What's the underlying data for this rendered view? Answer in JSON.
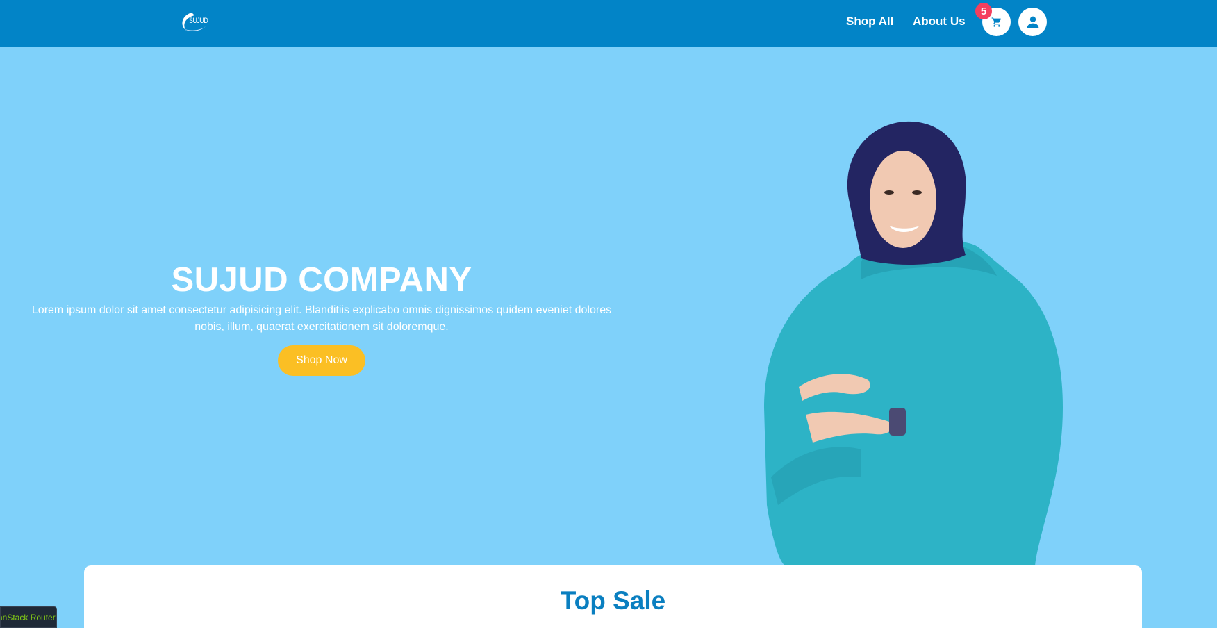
{
  "nav": {
    "logo_text": "SUJUD",
    "links": [
      {
        "label": "Shop All"
      },
      {
        "label": "About Us"
      }
    ],
    "cart_count": "5",
    "cart_icon": "cart-icon",
    "user_icon": "user-icon"
  },
  "hero": {
    "title": "SUJUD COMPANY",
    "description": "Lorem ipsum dolor sit amet consectetur adipisicing elit. Blanditiis explicabo omnis dignissimos quidem eveniet dolores nobis, illum, quaerat exercitationem sit doloremque.",
    "cta_label": "Shop Now"
  },
  "top_sale": {
    "title": "Top Sale"
  },
  "devtools": {
    "label": "TanStack Router"
  },
  "colors": {
    "nav_bg": "#0284c7",
    "hero_bg": "#7fd1fa",
    "cta_bg": "#fbbf24",
    "badge_bg": "#f43f5e",
    "heading_blue": "#0a7fc0"
  }
}
